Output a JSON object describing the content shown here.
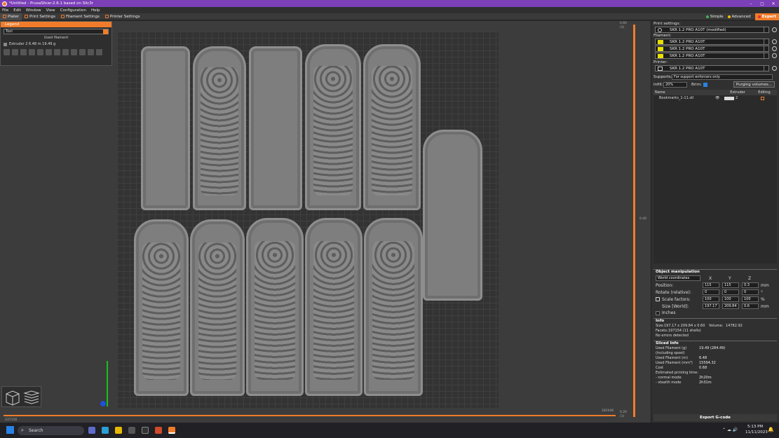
{
  "window": {
    "title": "*Untitled - PrusaSlicer-2.6.1 based on Slic3r",
    "controls": [
      "–",
      "▢",
      "✕"
    ]
  },
  "menu": [
    "File",
    "Edit",
    "Window",
    "View",
    "Configuration",
    "Help"
  ],
  "tabs": [
    {
      "label": "Plater"
    },
    {
      "label": "Print Settings"
    },
    {
      "label": "Filament Settings"
    },
    {
      "label": "Printer Settings"
    }
  ],
  "modes": {
    "simple": "Simple",
    "advanced": "Advanced",
    "expert": "Expert",
    "simple_color": "#4caf50",
    "advanced_color": "#f0c000"
  },
  "legend": {
    "title": "Legend",
    "tool": "Tool",
    "used_filament": "Used filament",
    "extruder_row": "Extruder 2   6.48 m   19.49 g"
  },
  "slider": {
    "top_v": "0.60",
    "top_l": "(3)",
    "mid": "0.40",
    "bot_v": "0.20",
    "bot_l": "(1)",
    "left": "237156",
    "right": "282046"
  },
  "sidebar": {
    "print_settings_label": "Print settings:",
    "print_profile": "SKR 1.2 PRO A10T (modified)",
    "filament_label": "Filament:",
    "filaments": [
      {
        "name": "SKR 1.2 PRO A10T",
        "color": "#e8e000"
      },
      {
        "name": "SKR 1.2 PRO A10T",
        "color": "#e8e000"
      },
      {
        "name": "SKR 1.2 PRO A10T",
        "color": "#e8e000"
      }
    ],
    "printer_label": "Printer:",
    "printer": "SKR 1.2 PRO A10T",
    "supports_label": "Supports:",
    "supports": "For support enforcers only",
    "infill_label": "Infill:",
    "infill": "20%",
    "brim_label": "Brim:",
    "purge_btn": "Purging volumes...",
    "col_name": "Name",
    "col_extruder": "Extruder",
    "col_editing": "Editing",
    "object": {
      "name": "Bookmarks_1-11.stl",
      "extruder": "2"
    },
    "om": {
      "title": "Object manipulation",
      "coords": "World coordinates",
      "x": "X",
      "y": "Y",
      "z": "Z",
      "position": "Position:",
      "pos": [
        "115",
        "115",
        "0.3"
      ],
      "pos_unit": "mm",
      "rotate": "Rotate (relative):",
      "rot": [
        "0",
        "0",
        "0"
      ],
      "rot_unit": "°",
      "scale": "Scale factors:",
      "sc": [
        "100",
        "100",
        "100"
      ],
      "sc_unit": "%",
      "size": "Size [World]:",
      "sz": [
        "197.17",
        "209.84",
        "0.6"
      ],
      "sz_unit": "mm",
      "inches": "Inches"
    },
    "info": {
      "title": "Info",
      "size_k": "Size:",
      "size_v": "197.17 x 209.84 x 0.60",
      "volume_k": "Volume:",
      "volume_v": "14782.92",
      "facets_k": "Facets:",
      "facets_v": "197154 (11 shells)",
      "errors": "No errors detected"
    },
    "sliced": {
      "title": "Sliced Info",
      "rows": [
        {
          "k": "Used Filament (g)",
          "v": "19.49 (284.49)"
        },
        {
          "k": "  (including spool)",
          "v": ""
        },
        {
          "k": "Used Filament (m)",
          "v": "6.48"
        },
        {
          "k": "Used Filament (mm³)",
          "v": "15594.32"
        },
        {
          "k": "Cost",
          "v": "0.68"
        },
        {
          "k": "Estimated printing time:",
          "v": ""
        },
        {
          "k": " - normal mode",
          "v": "2h20m"
        },
        {
          "k": " - stealth mode",
          "v": "2h31m"
        }
      ]
    },
    "export": "Export G-code"
  },
  "taskbar": {
    "search": "Search",
    "time": "5:13 PM",
    "date": "11/11/2023"
  }
}
